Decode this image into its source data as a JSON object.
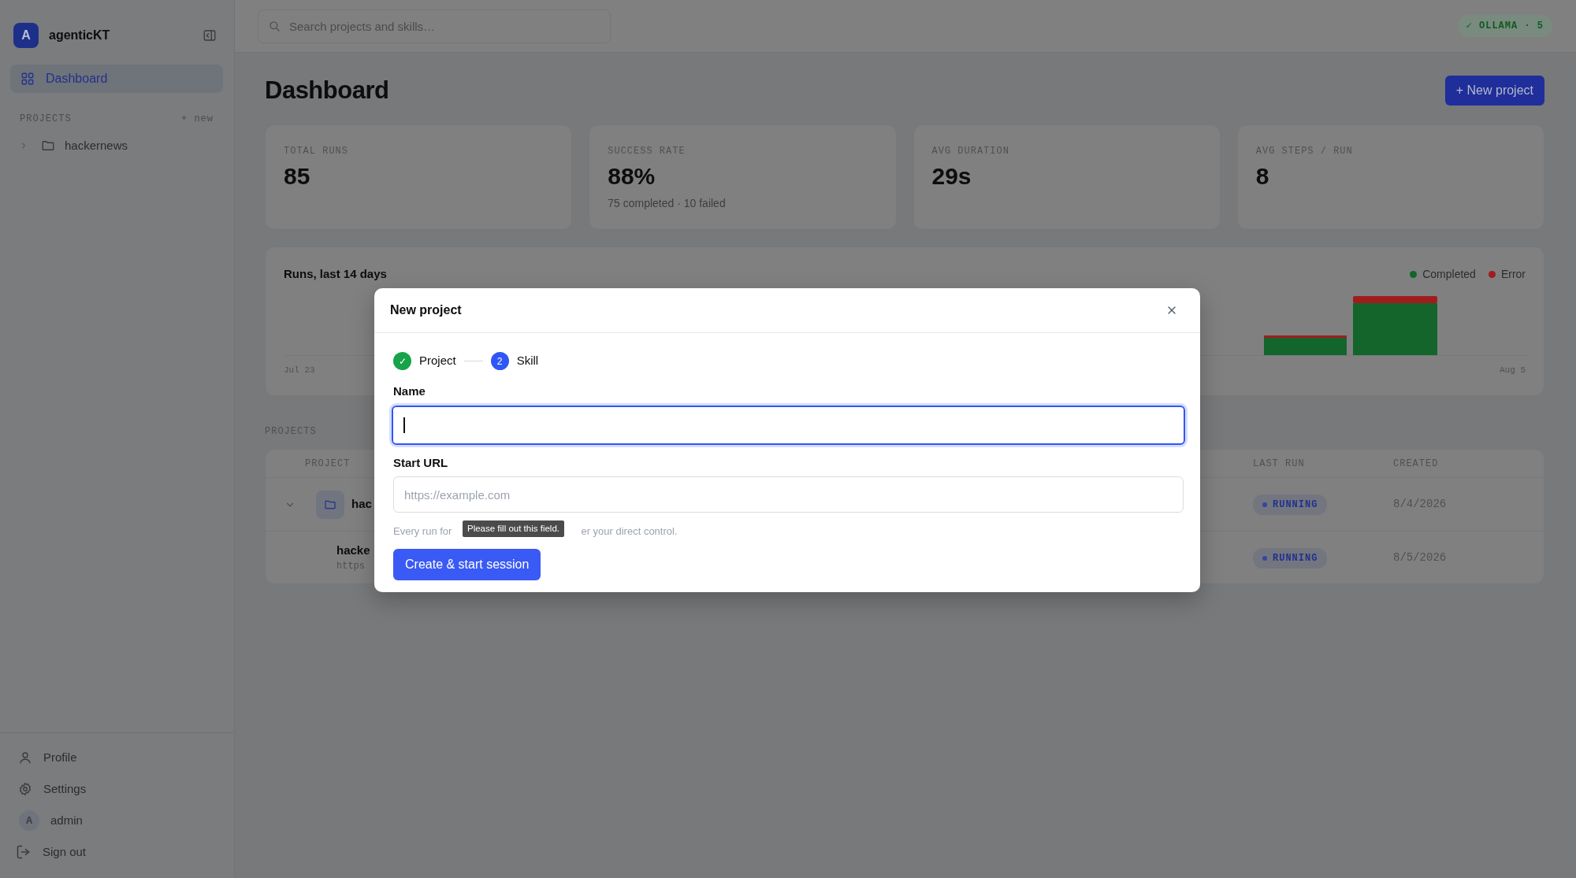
{
  "sidebar": {
    "brand": {
      "initial": "A",
      "name": "agenticKT"
    },
    "nav": [
      {
        "label": "Dashboard",
        "selected": true
      }
    ],
    "projects_heading": "PROJECTS",
    "new_link": "+ new",
    "projects": [
      {
        "label": "hackernews",
        "expanded": false
      }
    ],
    "footer": [
      {
        "kind": "person",
        "label": "Profile"
      },
      {
        "kind": "gear",
        "label": "Settings"
      },
      {
        "kind": "avatar",
        "initial": "A",
        "label": "admin"
      },
      {
        "kind": "exit",
        "label": "Sign out"
      }
    ]
  },
  "topbar": {
    "search_placeholder": "Search projects and skills…",
    "status_badge": "✓ OLLAMA · 5"
  },
  "page": {
    "title": "Dashboard",
    "new_button": "+ New project"
  },
  "stats": [
    {
      "label": "TOTAL RUNS",
      "value": "85"
    },
    {
      "label": "SUCCESS RATE",
      "value": "88%",
      "note": "75 completed · 10 failed"
    },
    {
      "label": "AVG DURATION",
      "value": "29s"
    },
    {
      "label": "AVG STEPS / RUN",
      "value": "8"
    }
  ],
  "chart": {
    "title": "Runs, last 14 days",
    "legend": [
      {
        "label": "Completed",
        "color": "#13652c"
      },
      {
        "label": "Error",
        "color": "#a11d1d"
      }
    ],
    "x_start": "Jul 23",
    "x_end": "Aug 5"
  },
  "projects_table": {
    "heading": "PROJECTS",
    "columns": [
      "PROJECT",
      "LAST RUN",
      "CREATED"
    ],
    "rows": [
      {
        "kind": "project",
        "expanded": true,
        "name": "hac",
        "last_run": "RUNNING",
        "created": "8/4/2026"
      },
      {
        "kind": "skill",
        "name": "hacke",
        "url": "https",
        "last_run": "RUNNING",
        "created": "8/5/2026"
      }
    ]
  },
  "modal": {
    "title": "New project",
    "steps": [
      {
        "label": "Project",
        "completed": true,
        "marker": "✓"
      },
      {
        "label": "Skill",
        "completed": false,
        "marker": "2"
      }
    ],
    "fields": [
      {
        "label": "Name",
        "focused": true
      },
      {
        "label": "Start URL",
        "placeholder": "https://example.com",
        "focused": false
      }
    ],
    "help_parts": [
      "Every run for",
      "er your direct control."
    ],
    "tooltip": "Please fill out this field.",
    "submit": "Create & start session"
  }
}
